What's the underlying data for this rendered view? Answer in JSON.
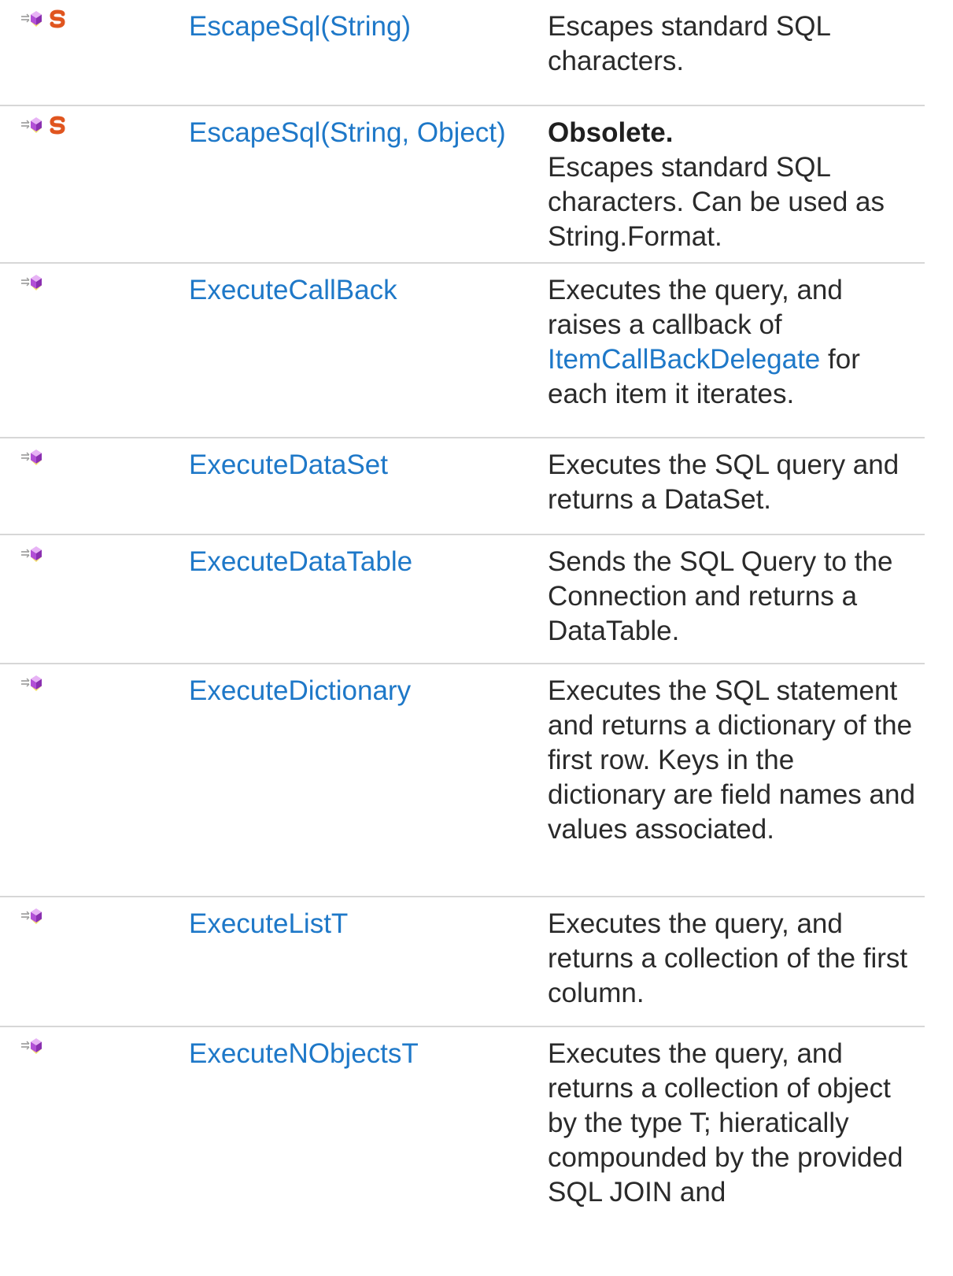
{
  "members": [
    {
      "name": "EscapeSql(String)",
      "static": true,
      "static_label": "S",
      "description": "Escapes standard SQL characters."
    },
    {
      "name": "EscapeSql(String, Object)",
      "static": true,
      "static_label": "S",
      "obsolete_label": "Obsolete.",
      "description": "Escapes standard SQL characters. Can be used as String.Format."
    },
    {
      "name": "ExecuteCallBack",
      "static": false,
      "description_before": "Executes the query, and raises a callback of",
      "description_link": "ItemCallBackDelegate",
      "description_after": "for each item it iterates."
    },
    {
      "name": "ExecuteDataSet",
      "static": false,
      "description": "Executes the SQL query and returns a DataSet."
    },
    {
      "name": "ExecuteDataTable",
      "static": false,
      "description": "Sends the SQL Query to the Connection and returns a DataTable."
    },
    {
      "name": "ExecuteDictionary",
      "static": false,
      "description": "Executes the SQL statement and returns a dictionary of the first row. Keys in the dictionary are field names and values associated."
    },
    {
      "name": "ExecuteListT",
      "static": false,
      "description": "Executes the query, and returns a collection of the first column."
    },
    {
      "name": "ExecuteNObjectsT",
      "static": false,
      "description": "Executes the query, and returns a collection of object by the type T; hieratically compounded by the provided SQL JOIN and"
    }
  ],
  "icons": {
    "method": "public-method-icon",
    "static": "static-member-icon"
  },
  "colors": {
    "link": "#1e78c8",
    "text": "#2a2a2a",
    "divider": "#d7d7d7",
    "static_badge": "#e0551f",
    "method_icon": "#b24fd6"
  }
}
